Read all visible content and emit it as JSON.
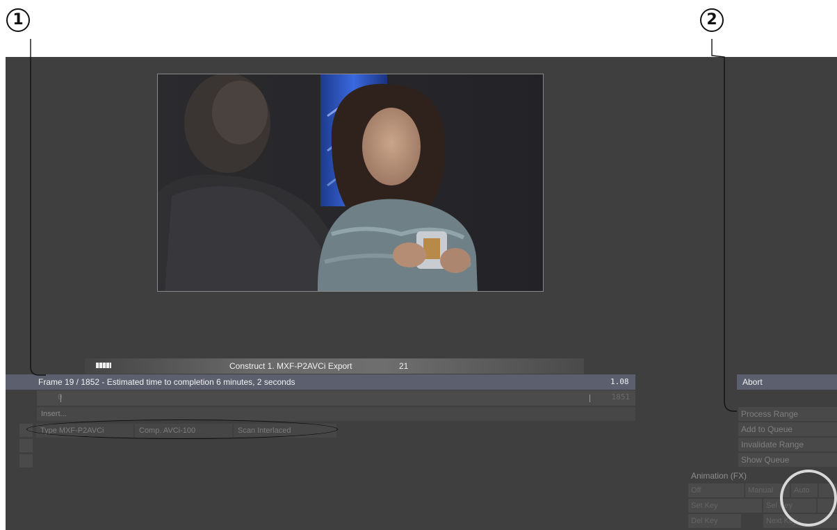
{
  "callouts": {
    "one": "1",
    "two": "2"
  },
  "processing": {
    "title": "Construct 1. MXF-P2AVCi Export",
    "count": "21",
    "status": "Frame 19 / 1852 - Estimated time to completion 6 minutes, 2 seconds",
    "ratio": "1.08",
    "abort_label": "Abort"
  },
  "timeline": {
    "start": "0",
    "end": "1851"
  },
  "insert_label": "Insert...",
  "format": {
    "type": "Type MXF-P2AVCi",
    "comp": "Comp. AVCi-100",
    "scan": "Scan Interlaced"
  },
  "actions": [
    "Process Range",
    "Add to Queue",
    "Invalidate Range",
    "Show Queue"
  ],
  "animation": {
    "label": "Animation (FX)",
    "buttons": [
      "Off",
      "Manual",
      "Auto",
      "Set Key",
      "Sel Key",
      "Del Key",
      "Next Key"
    ]
  }
}
